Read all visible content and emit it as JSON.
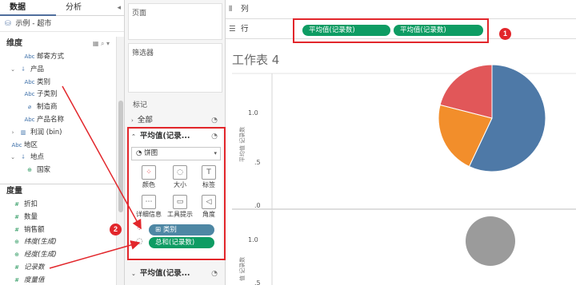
{
  "data_pane": {
    "tabs": [
      "数据",
      "分析"
    ],
    "datasource": "示例 - 超市",
    "dimensions_label": "维度",
    "dimensions": [
      {
        "type": "Abc",
        "label": "邮寄方式",
        "indent": 2
      },
      {
        "type": "hier",
        "label": "产品",
        "indent": 1,
        "caret": "⌄"
      },
      {
        "type": "Abc",
        "label": "类别",
        "indent": 2
      },
      {
        "type": "Abc",
        "label": "子类别",
        "indent": 2
      },
      {
        "type": "clip",
        "label": "制造商",
        "indent": 2
      },
      {
        "type": "Abc",
        "label": "产品名称",
        "indent": 2
      },
      {
        "type": "bar",
        "label": "利润 (bin)",
        "indent": 1,
        "caret": "›"
      },
      {
        "type": "Abc",
        "label": "地区",
        "indent": 1
      },
      {
        "type": "hier",
        "label": "地点",
        "indent": 1,
        "caret": "⌄"
      },
      {
        "type": "globe",
        "label": "国家",
        "indent": 2
      }
    ],
    "measures_label": "度量",
    "measures": [
      {
        "type": "#",
        "label": "折扣",
        "italic": false
      },
      {
        "type": "#",
        "label": "数量",
        "italic": false
      },
      {
        "type": "#",
        "label": "销售额",
        "italic": false
      },
      {
        "type": "globe",
        "label": "纬度(生成)",
        "italic": true
      },
      {
        "type": "globe",
        "label": "经度(生成)",
        "italic": true
      },
      {
        "type": "#",
        "label": "记录数",
        "italic": true
      },
      {
        "type": "#",
        "label": "度量值",
        "italic": true
      }
    ]
  },
  "cards": {
    "pages_label": "页面",
    "filters_label": "筛选器",
    "marks_label": "标记",
    "all_label": "全部",
    "marks_card1_label": "平均值(记录...",
    "mark_type": "饼图",
    "mark_buttons": [
      {
        "label": "颜色",
        "glyph": "⁘"
      },
      {
        "label": "大小",
        "glyph": "◌"
      },
      {
        "label": "标签",
        "glyph": "T"
      },
      {
        "label": "详细信息",
        "glyph": "⋯"
      },
      {
        "label": "工具提示",
        "glyph": "▭"
      },
      {
        "label": "角度",
        "glyph": "◁"
      }
    ],
    "encoding_pills": [
      {
        "label": "⊞ 类别",
        "kind": "color"
      },
      {
        "label": "总和(记录数)",
        "kind": "size"
      }
    ],
    "marks_card2_label": "平均值(记录..."
  },
  "shelves": {
    "columns_label": "列",
    "rows_label": "行",
    "row_pills": [
      "平均值(记录数)",
      "平均值(记录数)"
    ]
  },
  "view": {
    "sheet_title": "工作表 4",
    "axis_title_top": "平均值 记录数",
    "axis_title_bottom": "值 记录数",
    "ticks_top": [
      "1.0",
      ".5",
      ".0"
    ],
    "ticks_bottom": [
      "1.0",
      ".5"
    ]
  },
  "annotations": {
    "badge_1": "1",
    "badge_2": "2",
    "highlight_color": "#e2262b"
  },
  "colors": {
    "pill_green": "#0e9c63",
    "pill_blue": "#4e87a4",
    "pie_blue": "#4e79a7",
    "pie_orange": "#f28e2b",
    "pie_red": "#e15759",
    "pie_gray": "#9b9b9b"
  },
  "chart_data": [
    {
      "type": "pie",
      "categories": [
        "",
        "",
        ""
      ],
      "values": [
        57,
        22,
        21
      ]
    },
    {
      "type": "pie",
      "categories": [
        ""
      ],
      "values": [
        100
      ]
    }
  ]
}
